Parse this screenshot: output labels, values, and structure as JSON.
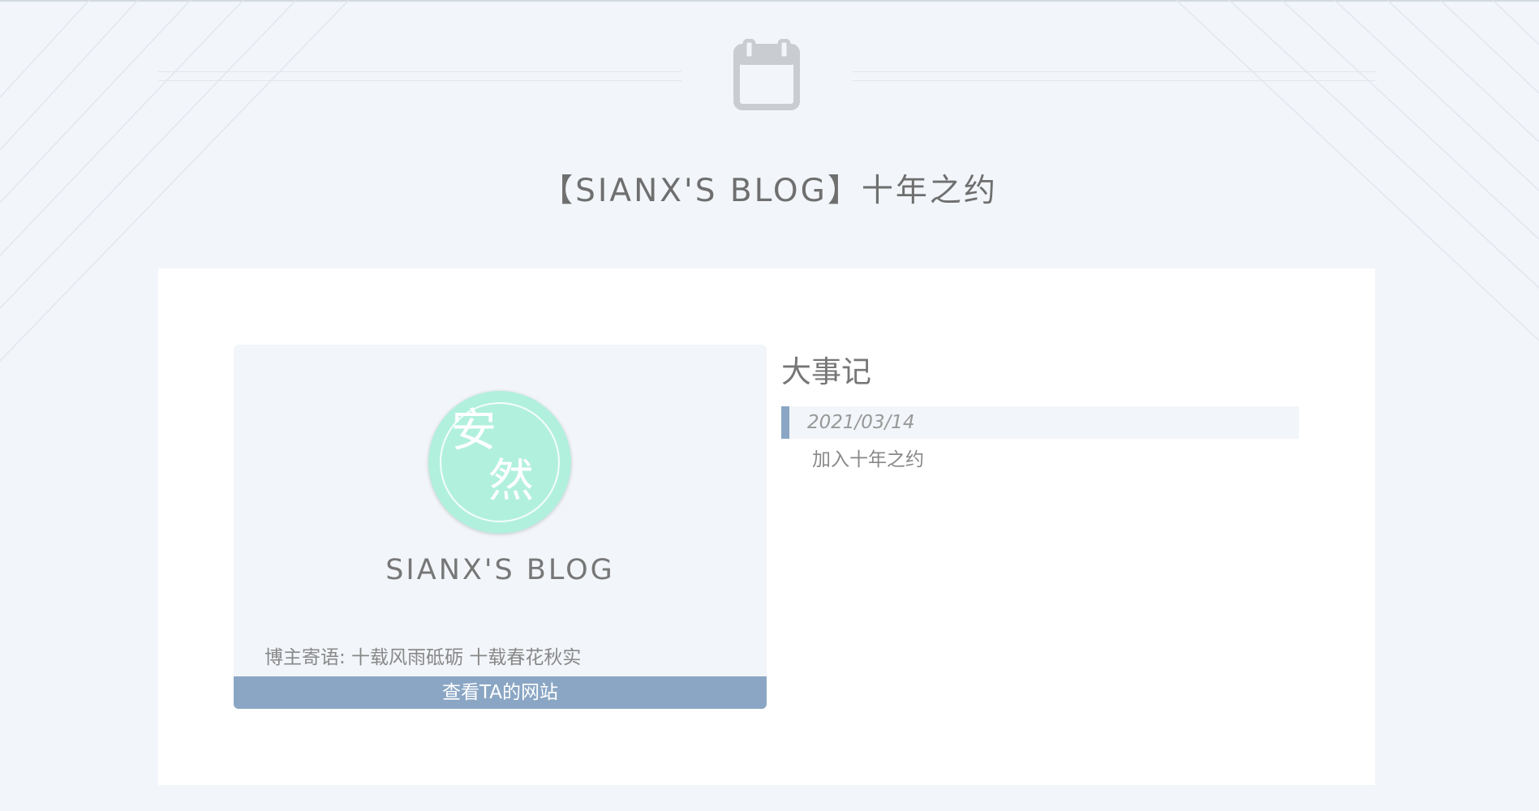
{
  "page": {
    "title": "【SIANX'S BLOG】十年之约",
    "icon": "calendar-icon"
  },
  "profile": {
    "avatar_glyphs": [
      "安",
      "然"
    ],
    "blog_name": "SIANX'S BLOG",
    "motto": "博主寄语: 十载风雨砥砺 十载春花秋实",
    "visit_button_label": "查看TA的网站"
  },
  "events": {
    "title": "大事记",
    "items": [
      {
        "date": "2021/03/14",
        "description": "加入十年之约"
      }
    ]
  },
  "colors": {
    "background": "#f2f5f9",
    "card": "#ffffff",
    "accent": "#8aa6c4",
    "avatar": "#b2f0de",
    "text": "#777777"
  }
}
